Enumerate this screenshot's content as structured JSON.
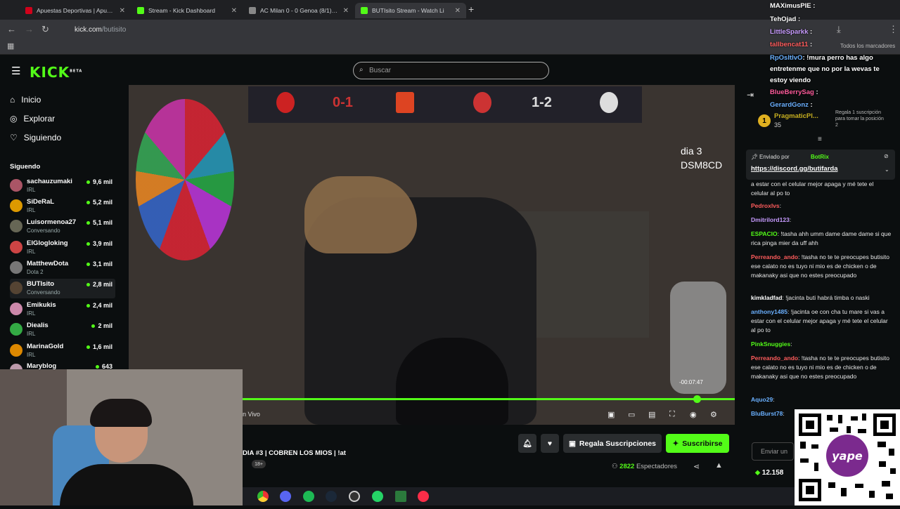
{
  "browser": {
    "tabs": [
      {
        "title": "Apuestas Deportivas | Apuesta",
        "color": "#d0021b",
        "active": false
      },
      {
        "title": "Stream - Kick Dashboard",
        "color": "#53fc18",
        "active": false
      },
      {
        "title": "AC Milan 0 - 0 Genoa (8/1): Re",
        "color": "#888888",
        "active": false
      },
      {
        "title": "BUTIsito Stream - Watch Li",
        "color": "#53fc18",
        "active": true
      }
    ],
    "url_host": "kick.com",
    "url_path": "/butisito",
    "bookmarks_label": "Todos los marcadores"
  },
  "kick": {
    "logo": "KICK",
    "logo_tag": "BETA",
    "search_placeholder": "Buscar",
    "nav": [
      {
        "label": "Inicio",
        "icon": "home-icon"
      },
      {
        "label": "Explorar",
        "icon": "compass-icon"
      },
      {
        "label": "Siguiendo",
        "icon": "heart-icon"
      }
    ],
    "following_title": "Siguendo",
    "channels": [
      {
        "name": "sachauzumaki",
        "category": "IRL",
        "viewers": "9,6 mil",
        "color": "#a56"
      },
      {
        "name": "SiDeRaL",
        "category": "IRL",
        "viewers": "5,2 mil",
        "color": "#d90"
      },
      {
        "name": "Luisormenoa27",
        "category": "Conversando",
        "viewers": "5,1 mil",
        "color": "#665"
      },
      {
        "name": "ElGlogloking",
        "category": "IRL",
        "viewers": "3,9 mil",
        "color": "#c44"
      },
      {
        "name": "MatthewDota",
        "category": "Dota 2",
        "viewers": "3,1 mil",
        "color": "#777"
      },
      {
        "name": "BUTIsito",
        "category": "Conversando",
        "viewers": "2,8 mil",
        "color": "#543"
      },
      {
        "name": "Emikukis",
        "category": "IRL",
        "viewers": "2,4 mil",
        "color": "#c8a"
      },
      {
        "name": "Diealis",
        "category": "IRL",
        "viewers": "2 mil",
        "color": "#3a4"
      },
      {
        "name": "MarinaGold",
        "category": "IRL",
        "viewers": "1,6 mil",
        "color": "#d80"
      },
      {
        "name": "Maryblog",
        "category": "",
        "viewers": "643",
        "color": "#b9a"
      }
    ]
  },
  "video": {
    "score_left": "0-1",
    "score_right": "1-2",
    "overlay_text_1": "dia 3",
    "overlay_text_2": "DSM8CD",
    "time_left": "-00:07:47",
    "live_label": "n Vivo",
    "progress": 0.92
  },
  "stream": {
    "title": "DIA #3 | COBREN LOS MIOS | !at",
    "age": "18+",
    "gift_label": "Regala Suscripciones",
    "subscribe_label": "Suscribirse",
    "viewers_count": "2822",
    "viewers_label": "Espectadores"
  },
  "chat_overlay": [
    {
      "user": "MAXimusPIE",
      "color": "#ffffff",
      "text": ":"
    },
    {
      "user": "TehOjad",
      "color": "#ffffff",
      "text": ":"
    },
    {
      "user": "LittleSparkk",
      "color": "#c79bff",
      "text": ":"
    },
    {
      "user": "tallbencat11",
      "color": "#ff5c5c",
      "text": ":"
    },
    {
      "user": "RpOsItIvO",
      "color": "#6ab0ff",
      "text": ": !mura perro has algo"
    },
    {
      "user": "",
      "color": "#ffffff",
      "text": "entretenme que no por la wevas te"
    },
    {
      "user": "",
      "color": "#ffffff",
      "text": "estoy viendo"
    },
    {
      "user": "BlueBerrySag",
      "color": "#ff5c9c",
      "text": ":"
    },
    {
      "user": "GerardGonz",
      "color": "#6ab0ff",
      "text": ":"
    }
  ],
  "chat": {
    "top_gifter_rank": "1",
    "top_gifter_name": "PragmaticPl...",
    "top_gifter_count": "35",
    "gift_hint": "Regala 1 suscripción para tomar la posición 2",
    "pinned_by_label": "Enviado por",
    "pinned_by": "BotRix",
    "pinned_link": "https://discord.gg/butifarda",
    "input_placeholder": "Enviar un",
    "points": "12.158",
    "messages": [
      {
        "user": "",
        "color": "#e8e8e8",
        "text": "a estar con el celular mejor apaga y mé tete el celular al po to"
      },
      {
        "user": "Pedroxlvs",
        "color": "#ff5c5c",
        "text": ":"
      },
      {
        "user": "Dmitrilord123",
        "color": "#c79bff",
        "text": ":"
      },
      {
        "user": "ESPACIO",
        "color": "#53fc18",
        "text": ": !tasha ahh umm dame dame dame si que rica pinga mier da uff ahh"
      },
      {
        "user": "Perreando_ando",
        "color": "#ff5c5c",
        "text": ": !tasha no te te preocupes butisito ese calato no es tuyo ni mio es de chicken o de makanaky asi que no estes preocupado"
      },
      {
        "user": "kimkladfad",
        "color": "#ffffff",
        "text": ": !jacinta buti habrá timba o naski"
      },
      {
        "user": "anthony1485",
        "color": "#6ab0ff",
        "text": ": !jacinta oe con cha tu mare si vas a estar con el celular mejor apaga y mé tete el celular al po to"
      },
      {
        "user": "PinkSnuggies",
        "color": "#53fc18",
        "text": ":"
      },
      {
        "user": "Perreando_ando",
        "color": "#ff5c5c",
        "text": ": !tasha no te te preocupes butisito ese calato no es tuyo ni mio es de chicken o de makanaky asi que no estes preocupado"
      },
      {
        "user": "Aquo29",
        "color": "#6ab0ff",
        "text": ":"
      },
      {
        "user": "BluBurst78",
        "color": "#6ab0ff",
        "text": ":"
      }
    ]
  }
}
